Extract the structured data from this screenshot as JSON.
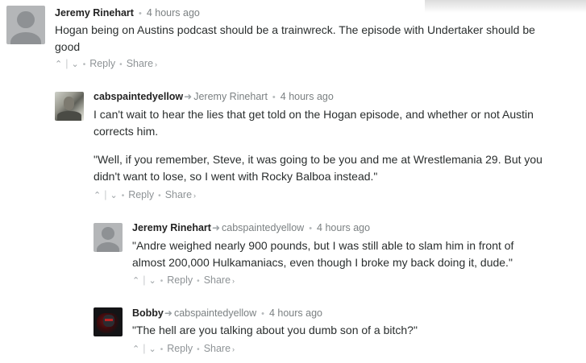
{
  "comments": [
    {
      "author": "Jeremy Rinehart",
      "reply_to": "",
      "time": "4 hours ago",
      "avatar": "default-avatar",
      "paragraphs": [
        "Hogan being on Austins podcast should be a trainwreck. The episode with Undertaker should be",
        "good"
      ],
      "actions": {
        "upvote": "^",
        "downvote": "v",
        "reply": "Reply",
        "share": "Share"
      }
    },
    {
      "author": "cabspaintedyellow",
      "reply_to": "Jeremy Rinehart",
      "time": "4 hours ago",
      "avatar": "user-photo",
      "paragraphs": [
        "I can't wait to hear the lies that get told on the Hogan episode, and whether or not Austin",
        "corrects him.",
        "\"Well, if you remember, Steve, it was going to be you and me at Wrestlemania 29. But you",
        "didn't want to lose, so I went with Rocky Balboa instead.\""
      ],
      "actions": {
        "upvote": "^",
        "downvote": "v",
        "reply": "Reply",
        "share": "Share"
      }
    },
    {
      "author": "Jeremy Rinehart",
      "reply_to": "cabspaintedyellow",
      "time": "4 hours ago",
      "avatar": "default-avatar",
      "paragraphs": [
        "\"Andre weighed nearly 900 pounds, but I was still able to slam him in front of",
        "almost 200,000 Hulkamaniacs, even though I broke my back doing it, dude.\""
      ],
      "actions": {
        "upvote": "^",
        "downvote": "v",
        "reply": "Reply",
        "share": "Share"
      }
    },
    {
      "author": "Bobby",
      "reply_to": "cabspaintedyellow",
      "time": "4 hours ago",
      "avatar": "user-photo",
      "paragraphs": [
        "\"The hell are you talking about you dumb son of a bitch?\""
      ],
      "actions": {
        "upvote": "^",
        "downvote": "v",
        "reply": "Reply",
        "share": "Share"
      }
    }
  ]
}
